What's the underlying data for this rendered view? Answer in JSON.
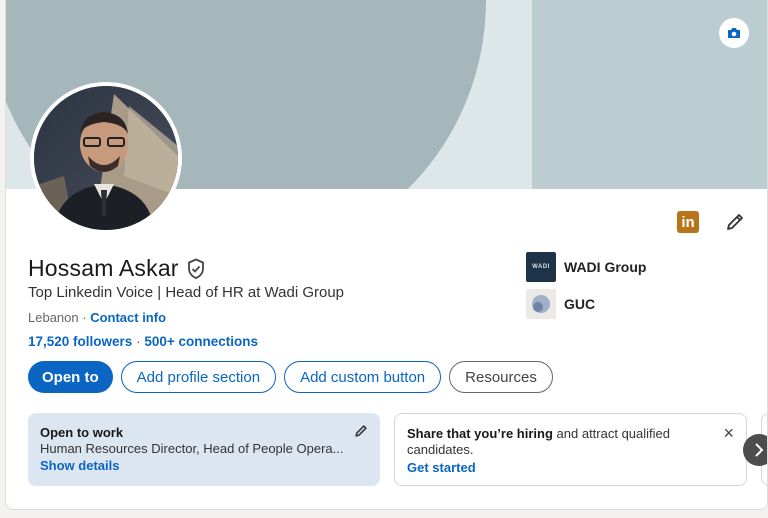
{
  "profile": {
    "name": "Hossam Askar",
    "headline": "Top Linkedin Voice | Head of HR at Wadi Group",
    "location": "Lebanon",
    "location_sep": " · ",
    "contact_info": "Contact info",
    "followers": "17,520 followers",
    "connections": "500+ connections",
    "conn_sep": " · "
  },
  "orgs": [
    {
      "name": "WADI Group",
      "logo_text": "WADI"
    },
    {
      "name": "GUC"
    }
  ],
  "actions": {
    "open_to": "Open to",
    "add_section": "Add profile section",
    "add_custom": "Add custom button",
    "resources": "Resources"
  },
  "open_to_work": {
    "title": "Open to work",
    "desc": "Human Resources Director, Head of People Opera...",
    "link": "Show details"
  },
  "hiring": {
    "bold": "Share that you’re hiring",
    "rest": " and attract qualified candidates.",
    "link": "Get started"
  },
  "icons": {
    "linkedin_badge": "in",
    "camera": "camera-icon",
    "edit": "pencil-icon",
    "close": "×",
    "next": "chevron-right-icon"
  },
  "colors": {
    "brand_blue": "#0a66c2",
    "open_to_work_bg": "#dce6f1",
    "linkedin_badge": "#b8741a"
  }
}
